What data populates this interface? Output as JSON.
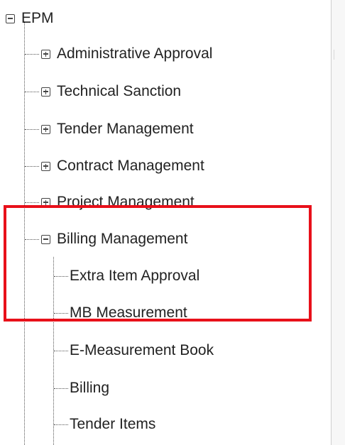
{
  "tree": {
    "root": {
      "label": "EPM",
      "expanded": true
    },
    "children": [
      {
        "label": "Administrative Approval",
        "expanded": false
      },
      {
        "label": "Technical Sanction",
        "expanded": false
      },
      {
        "label": "Tender Management",
        "expanded": false
      },
      {
        "label": "Contract Management",
        "expanded": false
      },
      {
        "label": "Project Management",
        "expanded": false
      },
      {
        "label": "Billing Management",
        "expanded": true,
        "children": [
          {
            "label": "Extra Item Approval"
          },
          {
            "label": "MB Measurement"
          },
          {
            "label": "E-Measurement Book"
          },
          {
            "label": "Billing"
          },
          {
            "label": "Tender Items"
          }
        ]
      }
    ]
  },
  "highlight": {
    "color": "#e8101a",
    "covers": [
      "Billing Management",
      "Extra Item Approval",
      "MB Measurement"
    ]
  }
}
